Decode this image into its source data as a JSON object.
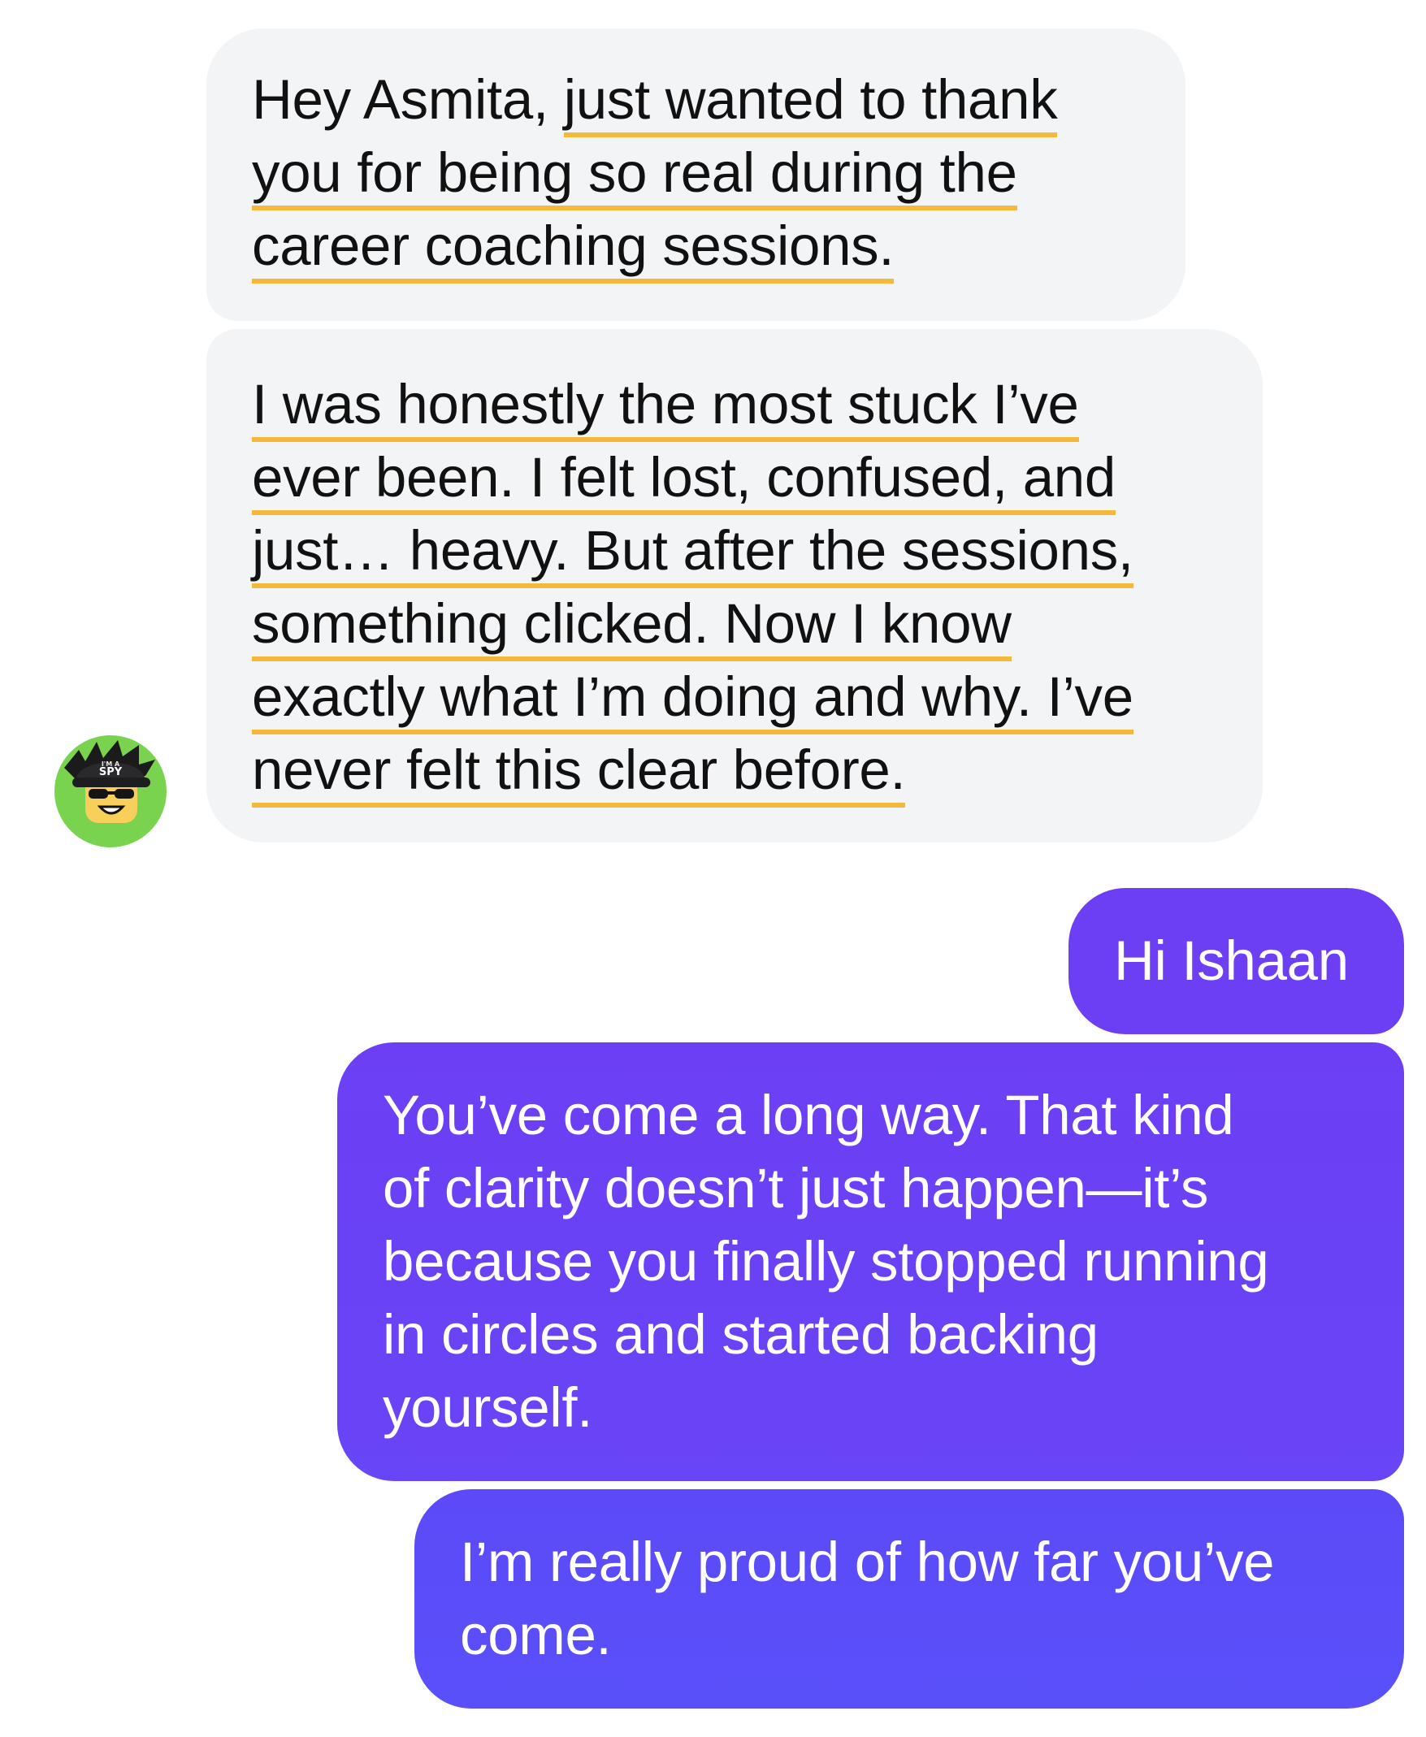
{
  "conversation": {
    "contact_avatar_text": [
      "I'M A",
      "SPY"
    ],
    "messages": [
      {
        "sender": "contact",
        "lines": [
          {
            "plain": "Hey Asmita, ",
            "underlined": "just wanted to thank"
          },
          {
            "plain": "",
            "underlined": "you for being so real during the"
          },
          {
            "plain": "",
            "underlined": "career coaching sessions."
          }
        ]
      },
      {
        "sender": "contact",
        "lines": [
          {
            "plain": "",
            "underlined": "I was honestly the most stuck I’ve"
          },
          {
            "plain": "",
            "underlined": "ever been. I felt lost, confused, and"
          },
          {
            "plain": "",
            "underlined": "just… heavy. But after the sessions,"
          },
          {
            "plain": "",
            "underlined": "something clicked. Now I know"
          },
          {
            "plain": "",
            "underlined": "exactly what I’m doing and why. I’ve"
          },
          {
            "plain": "",
            "underlined": "never felt this clear before."
          }
        ]
      },
      {
        "sender": "me",
        "lines": [
          "Hi Ishaan"
        ]
      },
      {
        "sender": "me",
        "lines": [
          "You’ve come a long way. That kind",
          "of clarity doesn’t just happen—it’s",
          "because you finally stopped running",
          "in circles and started backing",
          "yourself."
        ]
      },
      {
        "sender": "me",
        "lines": [
          "I’m really proud of how far you’ve",
          "come."
        ]
      }
    ]
  },
  "colors": {
    "incoming_bubble": "#f3f4f6",
    "outgoing_bubble": "#6c3ff5",
    "outgoing_bubble_last": "#5a50fa",
    "highlight_underline": "#f5b83a",
    "avatar_background": "#7ad34f"
  },
  "icons": {
    "avatar": "roblox-spy-avatar-icon"
  }
}
